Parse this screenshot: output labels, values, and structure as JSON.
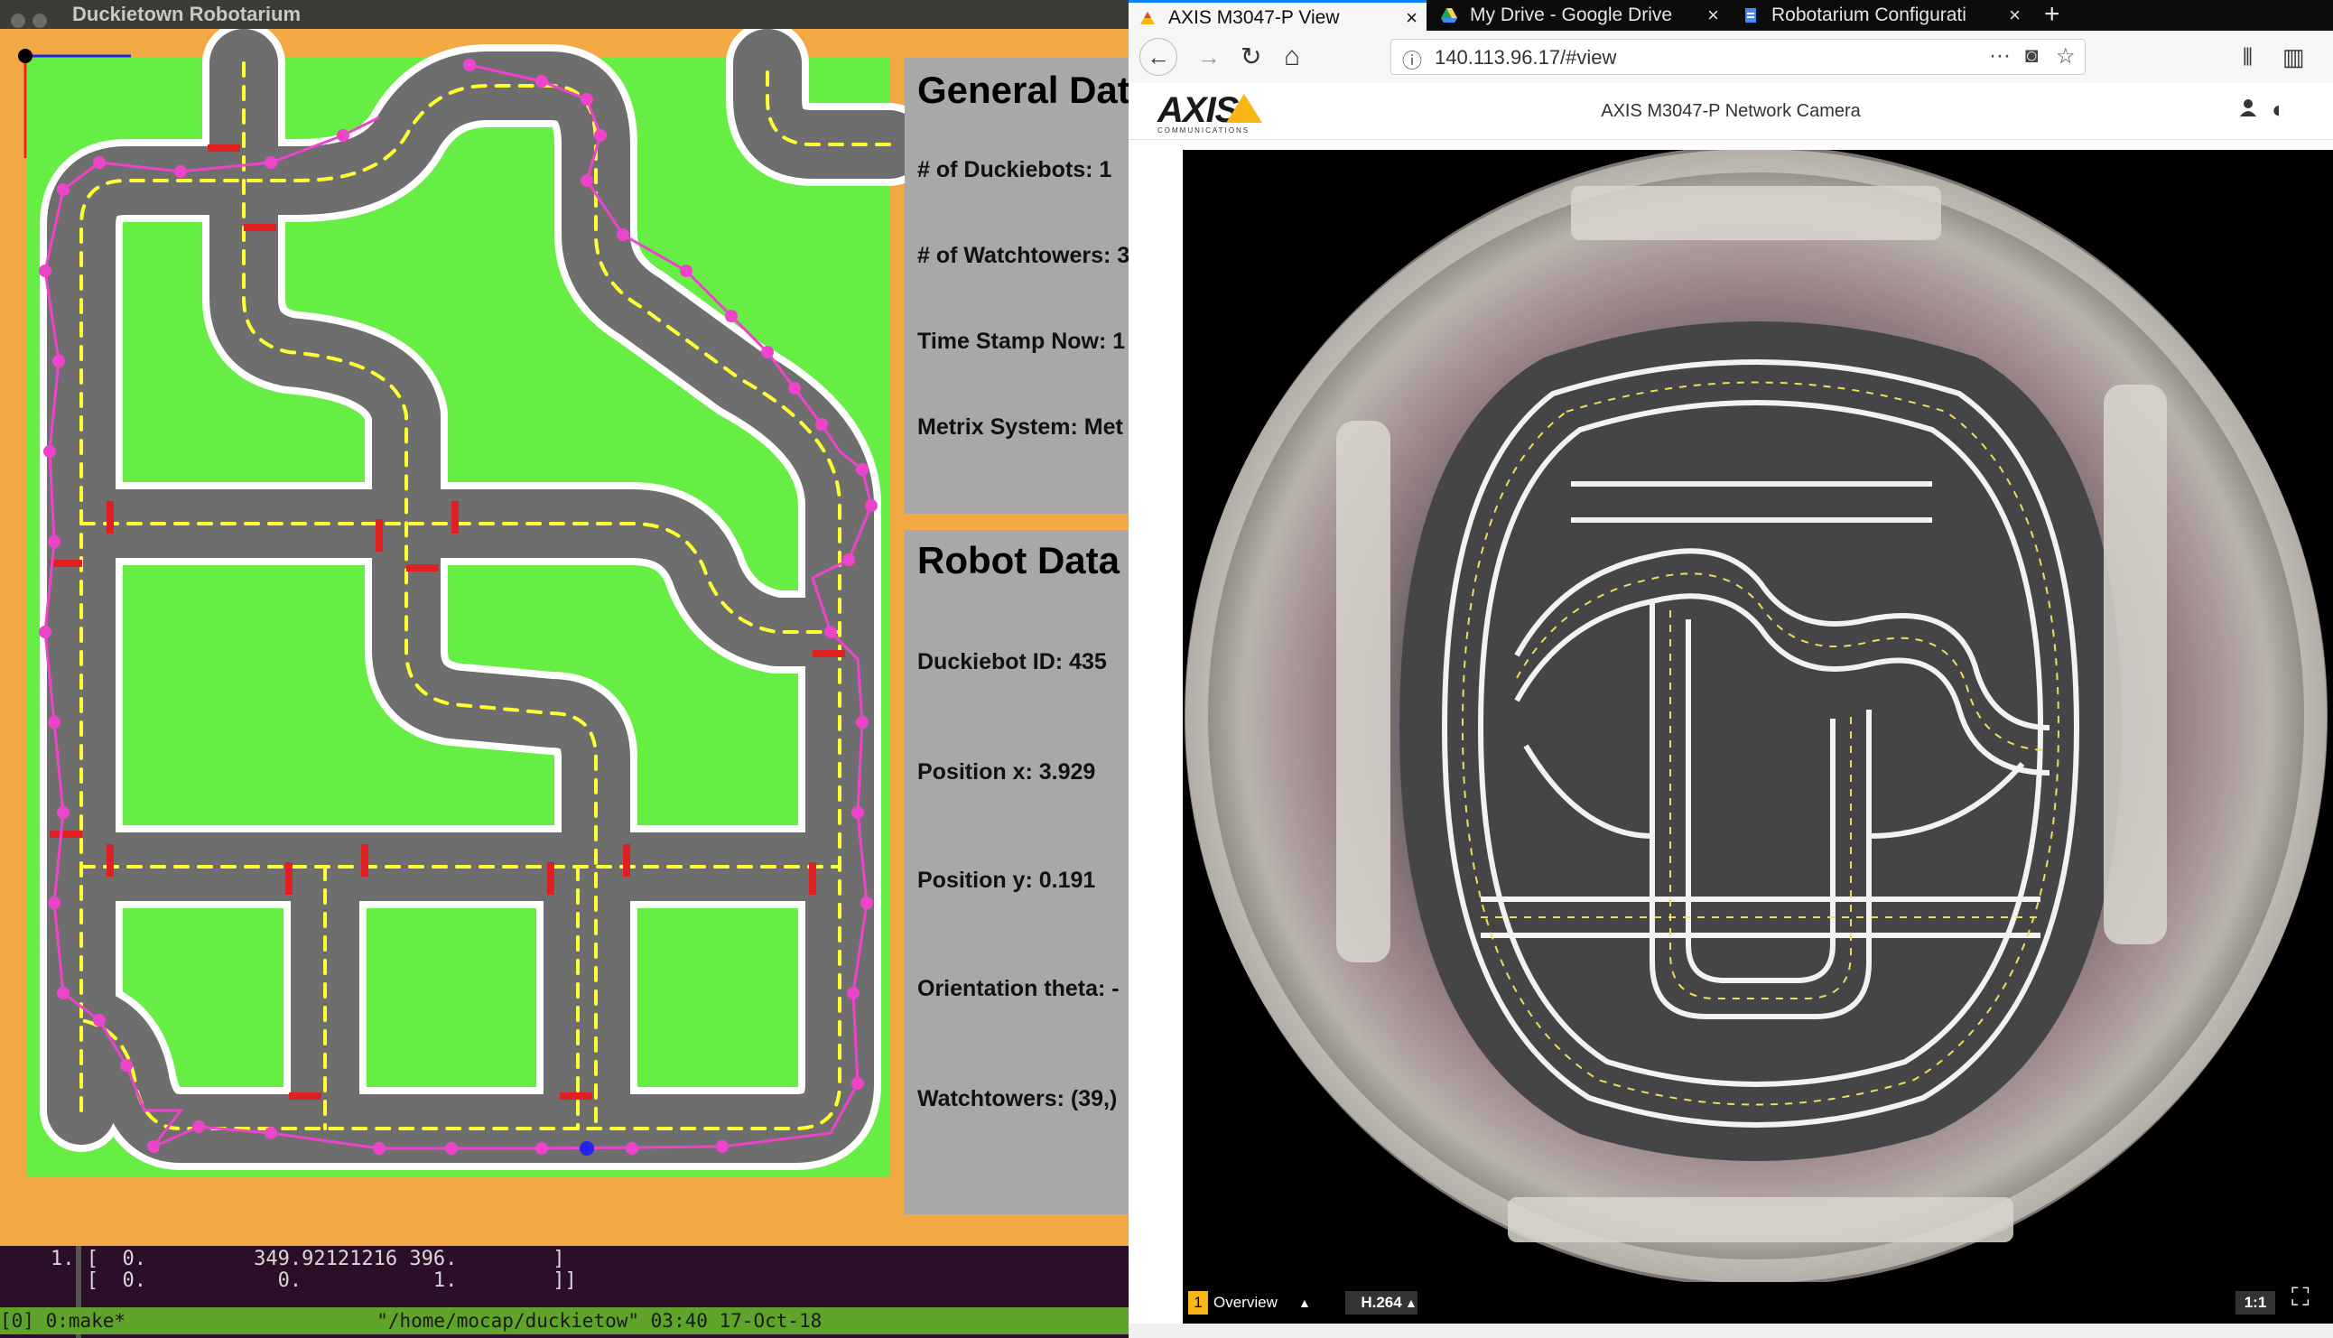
{
  "robotarium": {
    "window_title": "Duckietown Robotarium",
    "general": {
      "heading": "General Dat",
      "duckiebots": "# of Duckiebots: 1",
      "watchtowers": "# of Watchtowers: 3",
      "timestamp": "Time Stamp Now: 1",
      "metrix": "Metrix System: Met"
    },
    "robot": {
      "heading": "Robot Data",
      "id": "Duckiebot ID: 435",
      "pos_x": "Position x: 3.929",
      "pos_y": "Position y: 0.191",
      "theta": "Orientation theta: -",
      "watchtowers": "Watchtowers: (39,)"
    },
    "colors": {
      "background": "#f2a843",
      "grass": "#66ee44",
      "road": "#6e6e6e",
      "lane": "#ffff33",
      "stop": "#e02020",
      "trajectory": "#ee44cc",
      "panel": "#a8a8a8"
    }
  },
  "terminal": {
    "line1": "1. [  0.         349.92121216 396.        ]",
    "line2": "   [  0.           0.           1.        ]]",
    "status": "[0] 0:make*                      \"/home/mocap/duckietow\" 03:40 17-Oct-18"
  },
  "browser": {
    "tabs": [
      {
        "label": "AXIS M3047-P View",
        "icon": "axis-favicon",
        "active": true
      },
      {
        "label": "My Drive - Google Drive",
        "icon": "drive-favicon",
        "active": false
      },
      {
        "label": "Robotarium Configurati",
        "icon": "docs-favicon",
        "active": false
      }
    ],
    "new_tab": "+",
    "close_glyph": "×",
    "url": "140.113.96.17/#view",
    "nav": {
      "back": "←",
      "forward": "→",
      "reload": "↻",
      "home": "⌂",
      "more": "···",
      "pocket": "◙",
      "star": "☆",
      "library": "⫴",
      "sidebar": "▥"
    }
  },
  "camera": {
    "brand": "AXIS",
    "brand_sub": "COMMUNICATIONS",
    "title": "AXIS M3047-P Network Camera",
    "view_num": "1",
    "view_label": "Overview",
    "codec": "H.264",
    "zoom": "1:1",
    "fullscreen": "⛶",
    "user_icon": "👤",
    "contrast_icon": "◐"
  }
}
